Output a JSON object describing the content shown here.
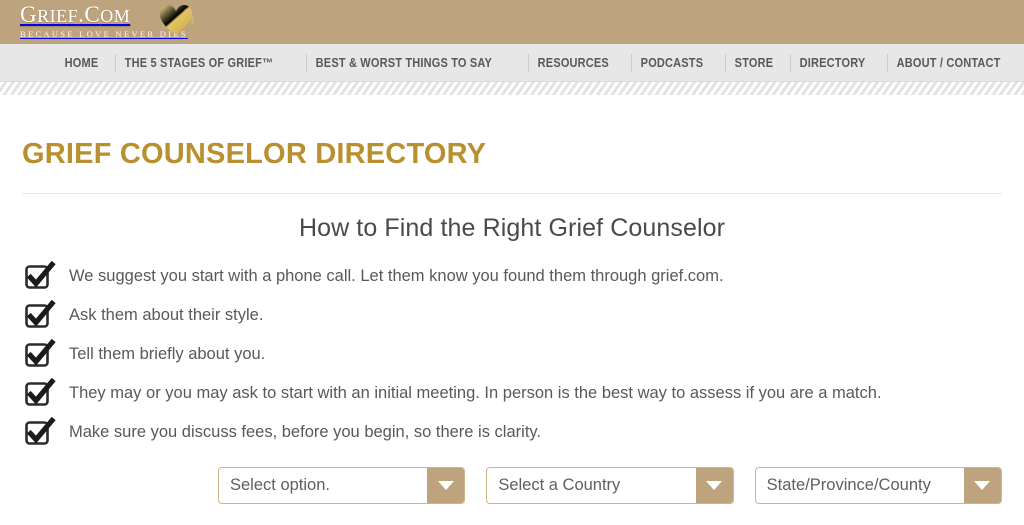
{
  "header": {
    "logo_word_primary": "G",
    "logo_word_rest": "RIEF",
    "logo_word_dot": ".",
    "logo_word_com_c": "C",
    "logo_word_com_rest": "OM",
    "logo_full": "GRIEF.COM",
    "tagline": "BECAUSE LOVE NEVER DIES",
    "heart_icon": "gold-heart-icon",
    "bg_color": "#bda47f"
  },
  "nav": {
    "bg_color": "#e7e7e7",
    "items": [
      {
        "label": "HOME"
      },
      {
        "label": "THE 5 STAGES OF GRIEF™"
      },
      {
        "label": "BEST & WORST THINGS TO SAY"
      },
      {
        "label": "RESOURCES"
      },
      {
        "label": "PODCASTS"
      },
      {
        "label": "STORE"
      },
      {
        "label": "DIRECTORY"
      },
      {
        "label": "ABOUT / CONTACT"
      }
    ]
  },
  "main": {
    "page_title": "GRIEF COUNSELOR DIRECTORY",
    "page_title_color": "#b8902f",
    "subtitle": "How to Find the Right Grief Counselor",
    "checklist": [
      {
        "icon": "checked-box-icon",
        "text": "We suggest you start with a phone call. Let them know you found them through grief.com."
      },
      {
        "icon": "checked-box-icon",
        "text": "Ask them about their style."
      },
      {
        "icon": "checked-box-icon",
        "text": "Tell them briefly about you."
      },
      {
        "icon": "checked-box-icon",
        "text": "They may or you may ask to start with an initial meeting. In person is the best way to assess if you are a match."
      },
      {
        "icon": "checked-box-icon",
        "text": "Make sure you discuss fees, before you begin, so there is clarity."
      }
    ],
    "filters": [
      {
        "value": "Select option.",
        "arrow_icon": "chevron-down-icon"
      },
      {
        "value": "Select a Country",
        "arrow_icon": "chevron-down-icon"
      },
      {
        "value": "State/Province/County",
        "arrow_icon": "chevron-down-icon"
      }
    ],
    "accent_color": "#bda47f"
  }
}
